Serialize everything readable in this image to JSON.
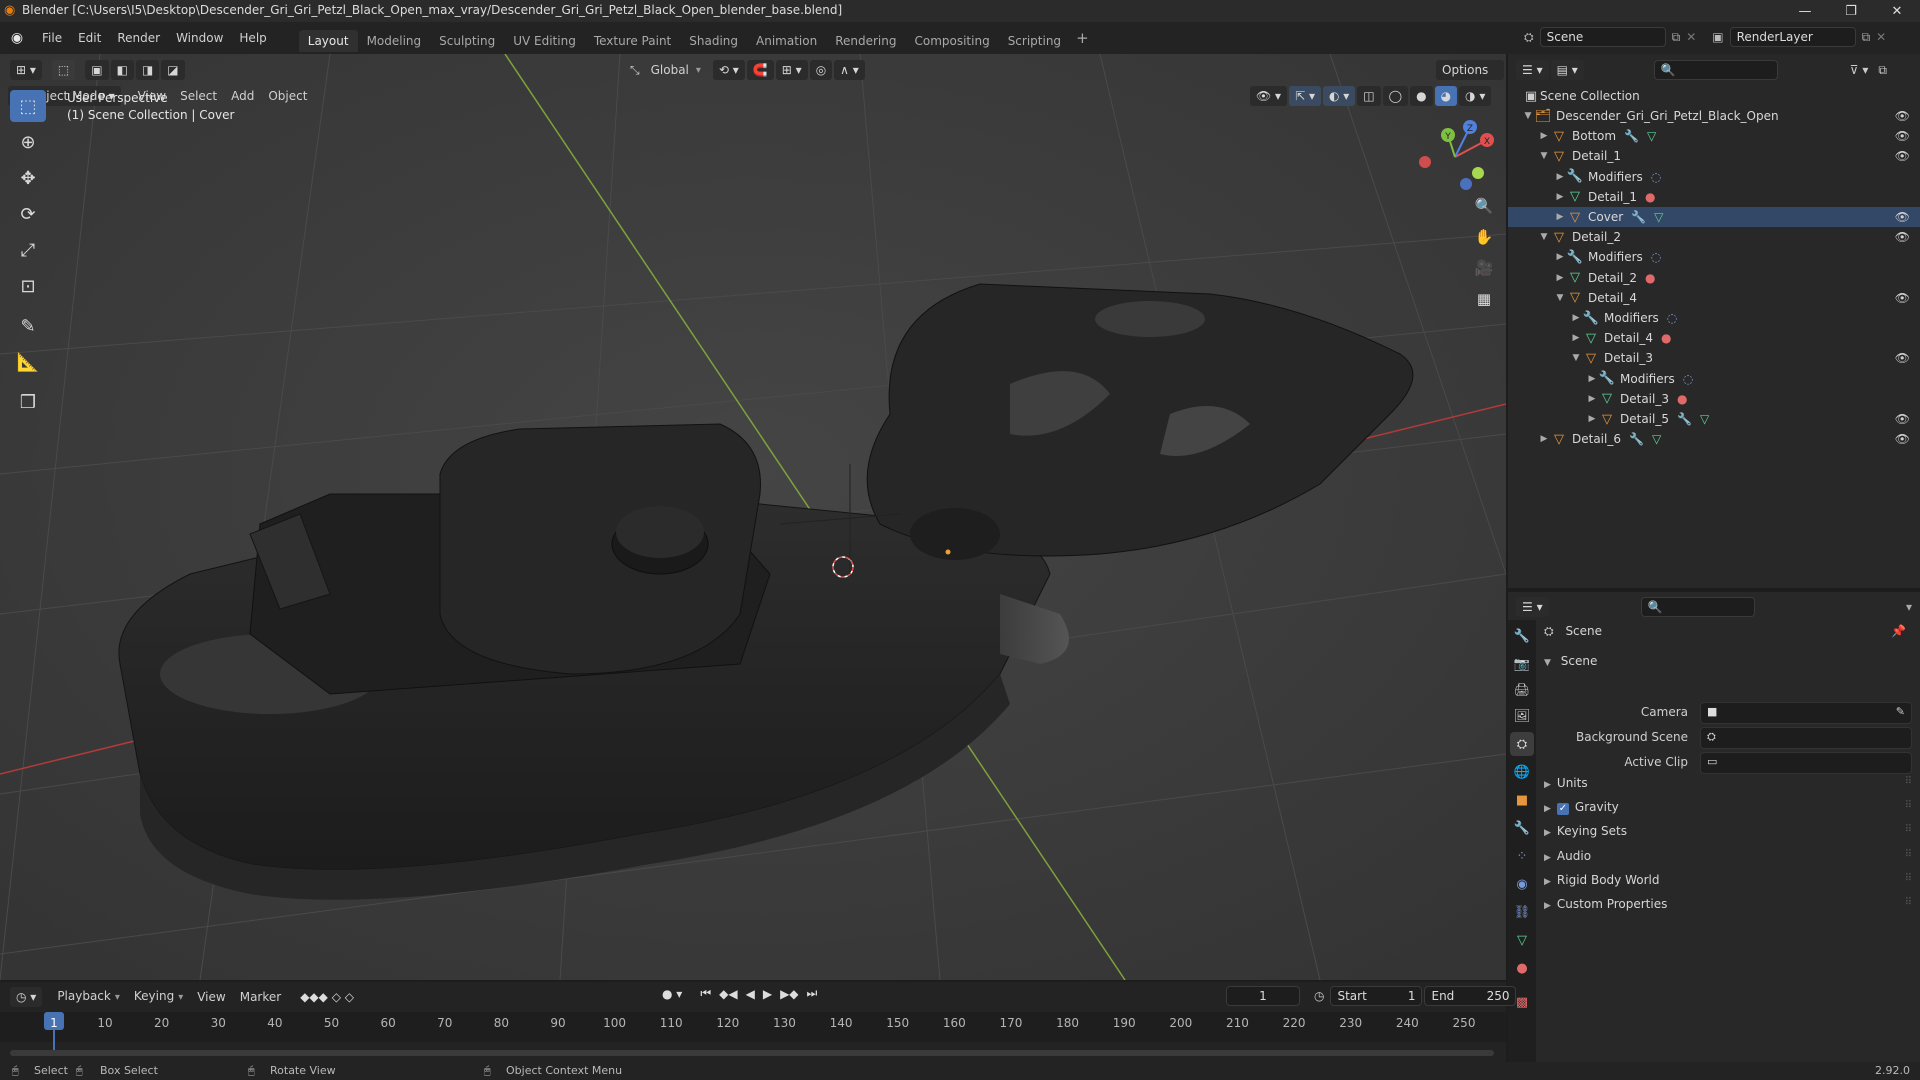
{
  "window": {
    "title": "Blender [C:\\Users\\I5\\Desktop\\Descender_Gri_Gri_Petzl_Black_Open_max_vray/Descender_Gri_Gri_Petzl_Black_Open_blender_base.blend]"
  },
  "menu": {
    "items": [
      "File",
      "Edit",
      "Render",
      "Window",
      "Help"
    ]
  },
  "workspaces": {
    "tabs": [
      "Layout",
      "Modeling",
      "Sculpting",
      "UV Editing",
      "Texture Paint",
      "Shading",
      "Animation",
      "Rendering",
      "Compositing",
      "Scripting"
    ],
    "active": "Layout",
    "add": "+"
  },
  "scene_selector": {
    "value": "Scene"
  },
  "renderlayer_selector": {
    "value": "RenderLayer"
  },
  "viewport": {
    "mode": "Object Mode",
    "menus": [
      "View",
      "Select",
      "Add",
      "Object"
    ],
    "transform_orientation": "Global",
    "options": "Options",
    "overlay_title": "User Perspective",
    "overlay_subtitle": "(1) Scene Collection | Cover",
    "gizmo": {
      "x": "X",
      "y": "Y",
      "z": "Z"
    }
  },
  "outliner": {
    "root": "Scene Collection",
    "rows": [
      {
        "label": "Descender_Gri_Gri_Petzl_Black_Open",
        "depth": 0,
        "icon": "collection-icon",
        "expanded": true,
        "eye": true
      },
      {
        "label": "Bottom",
        "depth": 1,
        "icon": "object-icon",
        "expanded": false,
        "eye": true,
        "extras": [
          "wrench-icon",
          "mesh-icon"
        ]
      },
      {
        "label": "Detail_1",
        "depth": 1,
        "icon": "object-icon",
        "expanded": true,
        "eye": true
      },
      {
        "label": "Modifiers",
        "depth": 2,
        "icon": "wrench-icon",
        "expanded": false,
        "extras": [
          "modifier-icon"
        ]
      },
      {
        "label": "Detail_1",
        "depth": 2,
        "icon": "mesh-icon",
        "expanded": false,
        "extras": [
          "material-icon"
        ]
      },
      {
        "label": "Cover",
        "depth": 2,
        "icon": "object-icon",
        "expanded": false,
        "eye": true,
        "extras": [
          "wrench-icon",
          "mesh-icon"
        ],
        "selected": true
      },
      {
        "label": "Detail_2",
        "depth": 1,
        "icon": "object-icon",
        "expanded": true,
        "eye": true
      },
      {
        "label": "Modifiers",
        "depth": 2,
        "icon": "wrench-icon",
        "expanded": false,
        "extras": [
          "modifier-icon"
        ]
      },
      {
        "label": "Detail_2",
        "depth": 2,
        "icon": "mesh-icon",
        "expanded": false,
        "extras": [
          "material-icon"
        ]
      },
      {
        "label": "Detail_4",
        "depth": 2,
        "icon": "object-icon",
        "expanded": true,
        "eye": true
      },
      {
        "label": "Modifiers",
        "depth": 3,
        "icon": "wrench-icon",
        "expanded": false,
        "extras": [
          "modifier-icon"
        ]
      },
      {
        "label": "Detail_4",
        "depth": 3,
        "icon": "mesh-icon",
        "expanded": false,
        "extras": [
          "material-icon"
        ]
      },
      {
        "label": "Detail_3",
        "depth": 3,
        "icon": "object-icon",
        "expanded": true,
        "eye": true
      },
      {
        "label": "Modifiers",
        "depth": 4,
        "icon": "wrench-icon",
        "expanded": false,
        "extras": [
          "modifier-icon"
        ]
      },
      {
        "label": "Detail_3",
        "depth": 4,
        "icon": "mesh-icon",
        "expanded": false,
        "extras": [
          "material-icon"
        ]
      },
      {
        "label": "Detail_5",
        "depth": 4,
        "icon": "object-icon",
        "expanded": false,
        "eye": true,
        "extras": [
          "wrench-icon",
          "mesh-icon"
        ]
      },
      {
        "label": "Detail_6",
        "depth": 1,
        "icon": "object-icon",
        "expanded": false,
        "eye": true,
        "extras": [
          "wrench-icon",
          "mesh-icon"
        ]
      }
    ]
  },
  "properties": {
    "header": "Scene",
    "panel_title": "Scene",
    "fields": [
      {
        "label": "Camera"
      },
      {
        "label": "Background Scene"
      },
      {
        "label": "Active Clip"
      }
    ],
    "sections": [
      {
        "label": "Units",
        "checkbox": false
      },
      {
        "label": "Gravity",
        "checkbox": true,
        "checked": true
      },
      {
        "label": "Keying Sets",
        "checkbox": false
      },
      {
        "label": "Audio",
        "checkbox": false
      },
      {
        "label": "Rigid Body World",
        "checkbox": false
      },
      {
        "label": "Custom Properties",
        "checkbox": false
      }
    ]
  },
  "timeline": {
    "menus": [
      "Playback",
      "Keying",
      "View",
      "Marker"
    ],
    "current_frame": "1",
    "start_label": "Start",
    "start": "1",
    "end_label": "End",
    "end": "250",
    "ticks": [
      "1",
      "10",
      "20",
      "30",
      "40",
      "50",
      "60",
      "70",
      "80",
      "90",
      "100",
      "110",
      "120",
      "130",
      "140",
      "150",
      "160",
      "170",
      "180",
      "190",
      "200",
      "210",
      "220",
      "230",
      "240",
      "250"
    ]
  },
  "statusbar": {
    "select": "Select",
    "box_select": "Box Select",
    "rotate_view": "Rotate View",
    "context_menu": "Object Context Menu",
    "version": "2.92.0"
  },
  "colors": {
    "accent": "#4772b3",
    "object": "#e8963c",
    "mesh": "#5fd39a",
    "grid_x": "#b43a3a",
    "grid_y": "#7ea23a"
  }
}
